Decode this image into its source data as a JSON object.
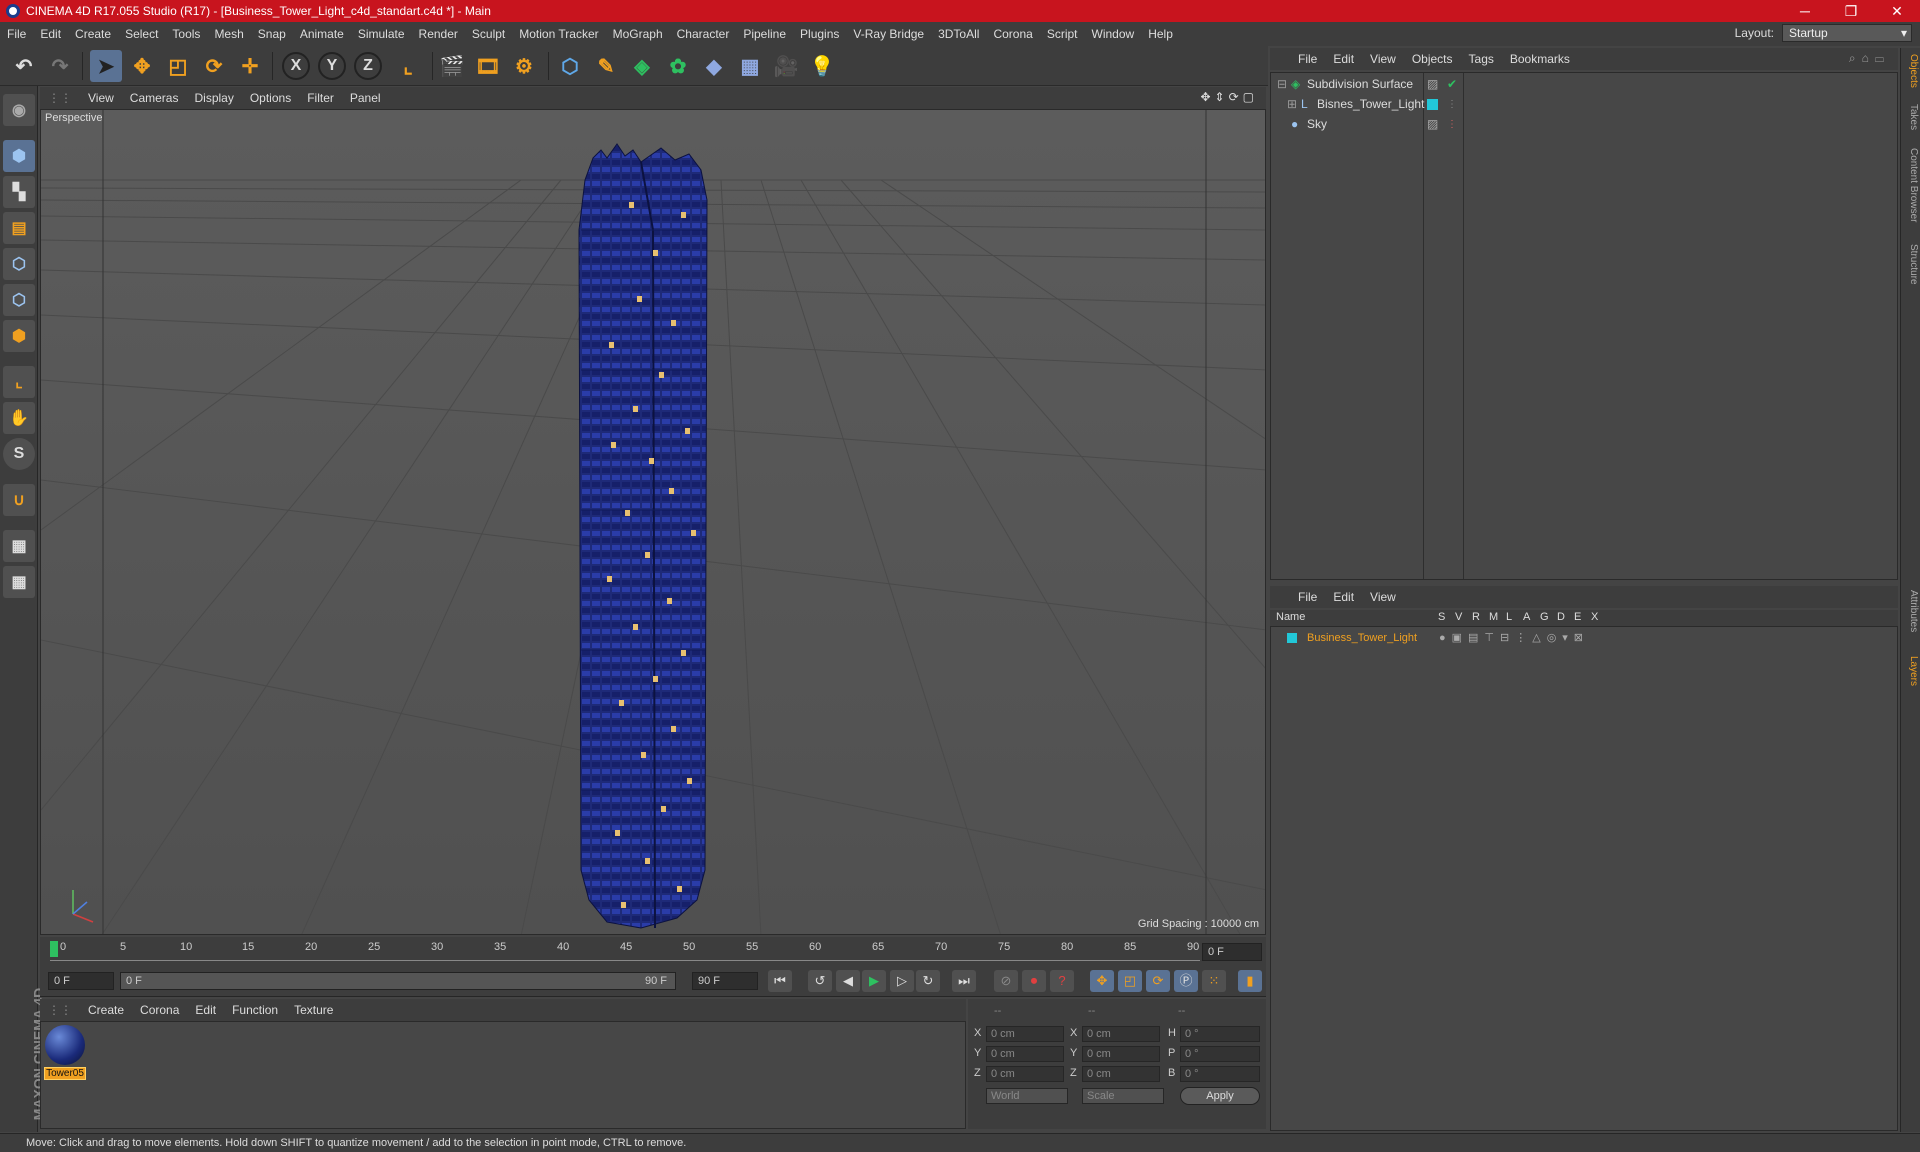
{
  "window": {
    "title": "CINEMA 4D R17.055 Studio (R17) - [Business_Tower_Light_c4d_standart.c4d *] - Main",
    "minimize": "─",
    "restore": "❐",
    "close": "✕"
  },
  "menubar": {
    "items": [
      "File",
      "Edit",
      "Create",
      "Select",
      "Tools",
      "Mesh",
      "Snap",
      "Animate",
      "Simulate",
      "Render",
      "Sculpt",
      "Motion Tracker",
      "MoGraph",
      "Character",
      "Pipeline",
      "Plugins",
      "V-Ray Bridge",
      "3DToAll",
      "Corona",
      "Script",
      "Window",
      "Help"
    ],
    "layout_label": "Layout:",
    "layout_value": "Startup"
  },
  "toolbar": {
    "axis_x": "X",
    "axis_y": "Y",
    "axis_z": "Z"
  },
  "viewport": {
    "menu": [
      "View",
      "Cameras",
      "Display",
      "Options",
      "Filter",
      "Panel"
    ],
    "camera": "Perspective",
    "grid_spacing": "Grid Spacing : 10000 cm"
  },
  "timeline": {
    "ticks": [
      "0",
      "5",
      "10",
      "15",
      "20",
      "25",
      "30",
      "35",
      "40",
      "45",
      "50",
      "55",
      "60",
      "65",
      "70",
      "75",
      "80",
      "85",
      "90"
    ],
    "current_frame": "0 F"
  },
  "transport": {
    "start": "0 F",
    "range_start": "0 F",
    "range_end": "90 F",
    "end": "90 F"
  },
  "material": {
    "menu": [
      "Create",
      "Corona",
      "Edit",
      "Function",
      "Texture"
    ],
    "items": [
      {
        "name": "Tower05"
      }
    ]
  },
  "coords": {
    "header": [
      "--",
      "--",
      "--"
    ],
    "rows": [
      {
        "a": "X",
        "av": "0 cm",
        "b": "X",
        "bv": "0 cm",
        "c": "H",
        "cv": "0 °"
      },
      {
        "a": "Y",
        "av": "0 cm",
        "b": "Y",
        "bv": "0 cm",
        "c": "P",
        "cv": "0 °"
      },
      {
        "a": "Z",
        "av": "0 cm",
        "b": "Z",
        "bv": "0 cm",
        "c": "B",
        "cv": "0 °"
      }
    ],
    "mode": "World",
    "scale": "Scale",
    "apply": "Apply"
  },
  "objects": {
    "menu": [
      "File",
      "Edit",
      "View",
      "Objects",
      "Tags",
      "Bookmarks"
    ],
    "items": [
      {
        "name": "Subdivision Surface"
      },
      {
        "name": "Bisnes_Tower_Light"
      },
      {
        "name": "Sky"
      }
    ]
  },
  "layers": {
    "menu": [
      "File",
      "Edit",
      "View"
    ],
    "columns": [
      "Name",
      "S",
      "V",
      "R",
      "M",
      "L",
      "A",
      "G",
      "D",
      "E",
      "X"
    ],
    "items": [
      {
        "name": "Business_Tower_Light"
      }
    ]
  },
  "side_tabs": [
    "Objects",
    "Takes",
    "Content Browser",
    "Structure",
    "Attributes",
    "Layers"
  ],
  "status": "Move: Click and drag to move elements. Hold down SHIFT to quantize movement / add to the selection in point mode, CTRL to remove.",
  "logo_text": "MAXON CINEMA 4D",
  "colors": {
    "title_bar": "#c8141e",
    "accent": "#f0a020",
    "layer_color": "#22c8d8"
  }
}
